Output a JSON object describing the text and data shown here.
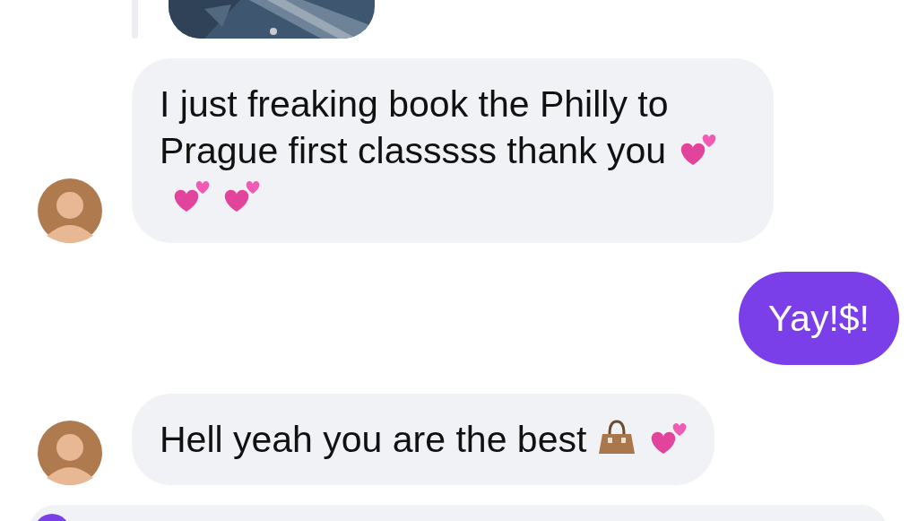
{
  "messages": [
    {
      "kind": "picture",
      "outgoing": false
    },
    {
      "kind": "text",
      "outgoing": false,
      "text": "I just freaking book the Philly to Prague first classsss thank you",
      "emoji": [
        {
          "kind": "two-hearts"
        },
        {
          "kind": "two-hearts"
        },
        {
          "kind": "two-hearts"
        }
      ]
    },
    {
      "kind": "text",
      "outgoing": true,
      "text": "Yay!$!"
    },
    {
      "kind": "text",
      "outgoing": false,
      "text": "Hell yeah you are the best",
      "emoji": [
        {
          "kind": "handbag"
        },
        {
          "kind": "two-hearts"
        }
      ]
    },
    {
      "kind": "cut",
      "outgoing": false
    }
  ]
}
